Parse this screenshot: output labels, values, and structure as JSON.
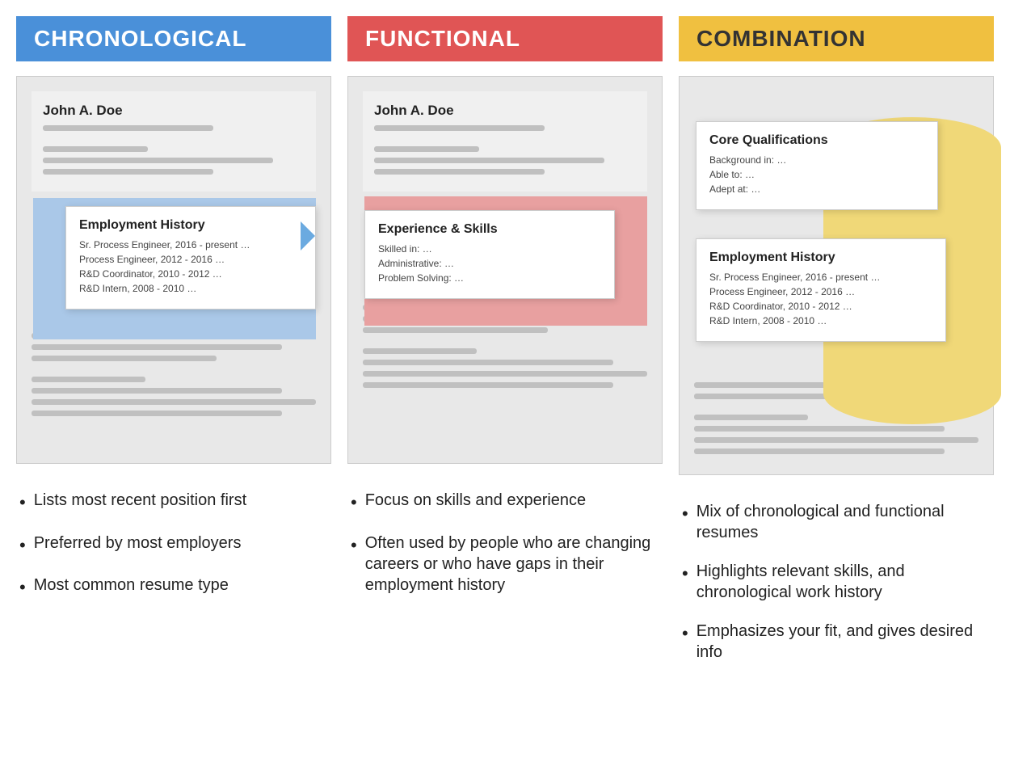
{
  "columns": [
    {
      "id": "chronological",
      "badge_text": "CHRONOLOGICAL",
      "badge_color": "blue",
      "resume": {
        "name": "John A. Doe",
        "popup_title": "Employment History",
        "popup_items": [
          "Sr. Process Engineer, 2016 - present …",
          "Process Engineer, 2012 - 2016 …",
          "R&D Coordinator, 2010 - 2012 …",
          "R&D Intern, 2008 - 2010 …"
        ]
      },
      "bullets": [
        "Lists most recent position first",
        "Preferred by most employers",
        "Most common resume type"
      ]
    },
    {
      "id": "functional",
      "badge_text": "FUNCTIONAL",
      "badge_color": "red",
      "resume": {
        "name": "John A. Doe",
        "popup_title": "Experience & Skills",
        "popup_items": [
          "Skilled in: …",
          "Administrative: …",
          "Problem Solving: …"
        ]
      },
      "bullets": [
        "Focus on skills and experience",
        "Often used by people who are changing careers or who have gaps in their employment history"
      ]
    },
    {
      "id": "combination",
      "badge_text": "COMBINATION",
      "badge_color": "yellow",
      "resume": {
        "core_title": "Core Qualifications",
        "core_items": [
          "Background in: …",
          "Able to: …",
          "Adept at: …"
        ],
        "popup_title": "Employment History",
        "popup_items": [
          "Sr. Process Engineer, 2016 - present …",
          "Process Engineer, 2012 - 2016 …",
          "R&D Coordinator, 2010 - 2012 …",
          "R&D Intern, 2008 - 2010 …"
        ]
      },
      "bullets": [
        "Mix of chronological and functional resumes",
        "Highlights relevant skills, and chronological work history",
        "Emphasizes your fit, and gives desired info"
      ]
    }
  ]
}
